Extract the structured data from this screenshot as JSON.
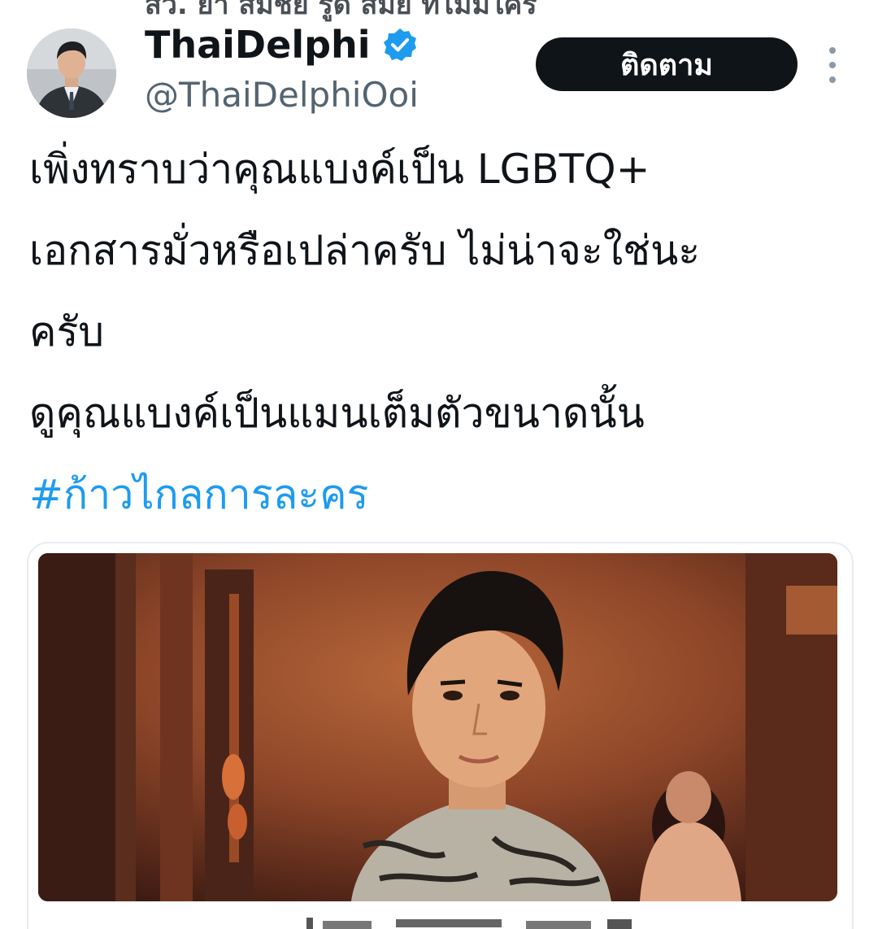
{
  "header": {
    "top_cut_text": "สว. ย้ำ สมชัย รู้ดี สมัย ที่ไม่มีใคร",
    "display_name": "ThaiDelphi",
    "handle": "@ThaiDelphiOoi",
    "follow_label": "ติดตาม"
  },
  "tweet": {
    "lines": [
      "เพิ่งทราบว่าคุณแบงค์เป็น LGBTQ+",
      "เอกสารมั่วหรือเปล่าครับ ไม่น่าจะใช่นะ",
      "ครับ",
      "ดูคุณแบงค์เป็นแมนเต็มตัวขนาดนั้น"
    ],
    "hashtag": "#ก้าวไกลการละคร"
  },
  "colors": {
    "accent": "#1d9bf0",
    "text": "#0f1419",
    "secondary_text": "#536471",
    "button_bg": "#0f1419"
  },
  "icons": {
    "verified": "verified-badge-icon",
    "more": "more-options-icon"
  }
}
